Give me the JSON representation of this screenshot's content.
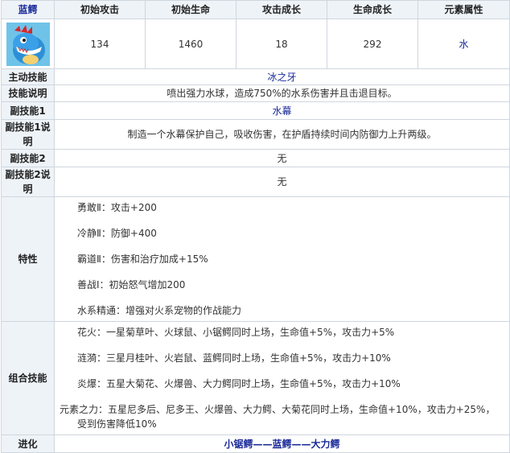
{
  "header": {
    "name": "蓝鳄",
    "col1": "初始攻击",
    "col2": "初始生命",
    "col3": "攻击成长",
    "col4": "生命成长",
    "col5": "元素属性"
  },
  "stats": {
    "attack": "134",
    "hp": "1460",
    "attack_growth": "18",
    "hp_growth": "292",
    "element": "水"
  },
  "rows": {
    "active_skill_label": "主动技能",
    "active_skill_value": "冰之牙",
    "skill_desc_label": "技能说明",
    "skill_desc_value": "喷出强力水球，造成750%的水系伤害并且击退目标。",
    "sub1_label": "副技能1",
    "sub1_value": "水幕",
    "sub1_desc_label": "副技能1说明",
    "sub1_desc_value": "制造一个水幕保护自己，吸收伤害，在护盾持续时间内防御力上升两级。",
    "sub2_label": "副技能2",
    "sub2_value": "无",
    "sub2_desc_label": "副技能2说明",
    "sub2_desc_value": "无"
  },
  "traits": {
    "label": "特性",
    "items": [
      "勇敢Ⅱ：攻击+200",
      "冷静Ⅱ：防御+400",
      "霸道Ⅱ：伤害和治疗加成+15%",
      "善战Ⅰ：初始怒气增加200",
      "水系精通：增强对火系宠物的作战能力"
    ]
  },
  "combos": {
    "label": "组合技能",
    "items": [
      "花火：一星菊草叶、火球鼠、小锯鳄同时上场，生命值+5%，攻击力+5%",
      "涟漪：三星月桂叶、火岩鼠、蓝鳄同时上场，生命值+5%，攻击力+10%",
      "炎爆：五星大菊花、火爆兽、大力鳄同时上场，生命值+5%，攻击力+10%",
      "元素之力：五星尼多后、尼多王、火爆兽、大力鳄、大菊花同时上场，生命值+10%，攻击力+25%，受到伤害降低10%"
    ]
  },
  "evolution": {
    "label": "进化",
    "chain": "小锯鳄——蓝鳄——大力鳄"
  },
  "colors": {
    "header_bg": "#eef3f8",
    "border": "#cfd6de",
    "accent_blue": "#1a2a99"
  }
}
